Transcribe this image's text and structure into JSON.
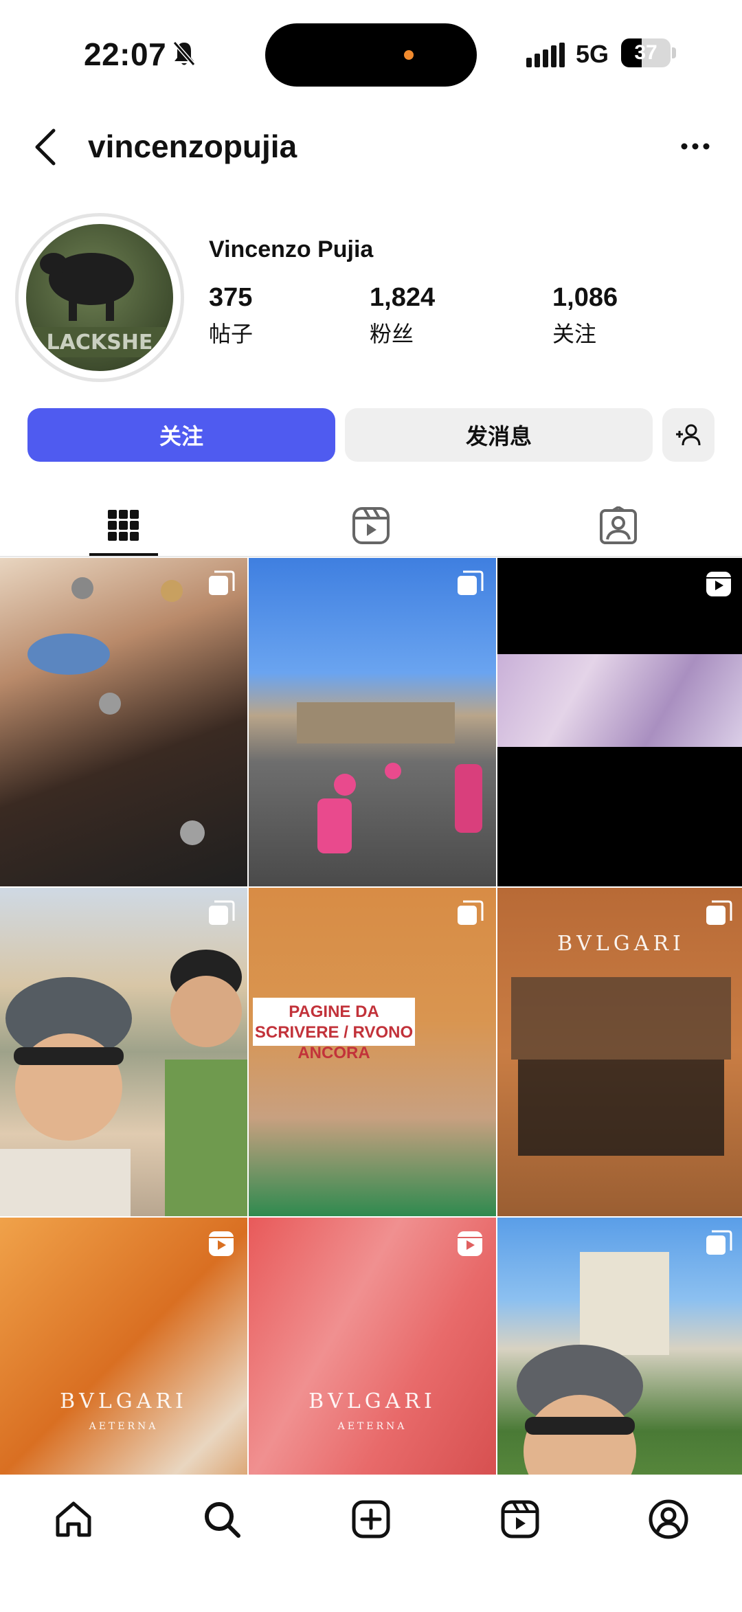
{
  "status_bar": {
    "time": "22:07",
    "network": "5G",
    "battery": "37"
  },
  "header": {
    "username": "vincenzopujia"
  },
  "profile": {
    "display_name": "Vincenzo Pujia",
    "avatar_text": "LACKSHE",
    "stats": [
      {
        "value": "375",
        "label": "帖子"
      },
      {
        "value": "1,824",
        "label": "粉丝"
      },
      {
        "value": "1,086",
        "label": "关注"
      }
    ]
  },
  "actions": {
    "follow_label": "关注",
    "message_label": "发消息"
  },
  "grid": {
    "posts": [
      {
        "type": "carousel",
        "caption": ""
      },
      {
        "type": "carousel",
        "caption": ""
      },
      {
        "type": "reel",
        "caption": ""
      },
      {
        "type": "carousel",
        "caption": ""
      },
      {
        "type": "carousel",
        "caption": "PAGINE DA SCRIVERE / RVONO ANCORA"
      },
      {
        "type": "carousel",
        "caption": "BVLGARI"
      },
      {
        "type": "reel",
        "caption": "BVLGARI",
        "sub": "AETERNA"
      },
      {
        "type": "reel",
        "caption": "BVLGARI",
        "sub": "AETERNA"
      },
      {
        "type": "carousel",
        "caption": ""
      }
    ]
  },
  "nav": {
    "items": [
      "home-icon",
      "search-icon",
      "create-icon",
      "reels-icon",
      "profile-icon"
    ]
  }
}
